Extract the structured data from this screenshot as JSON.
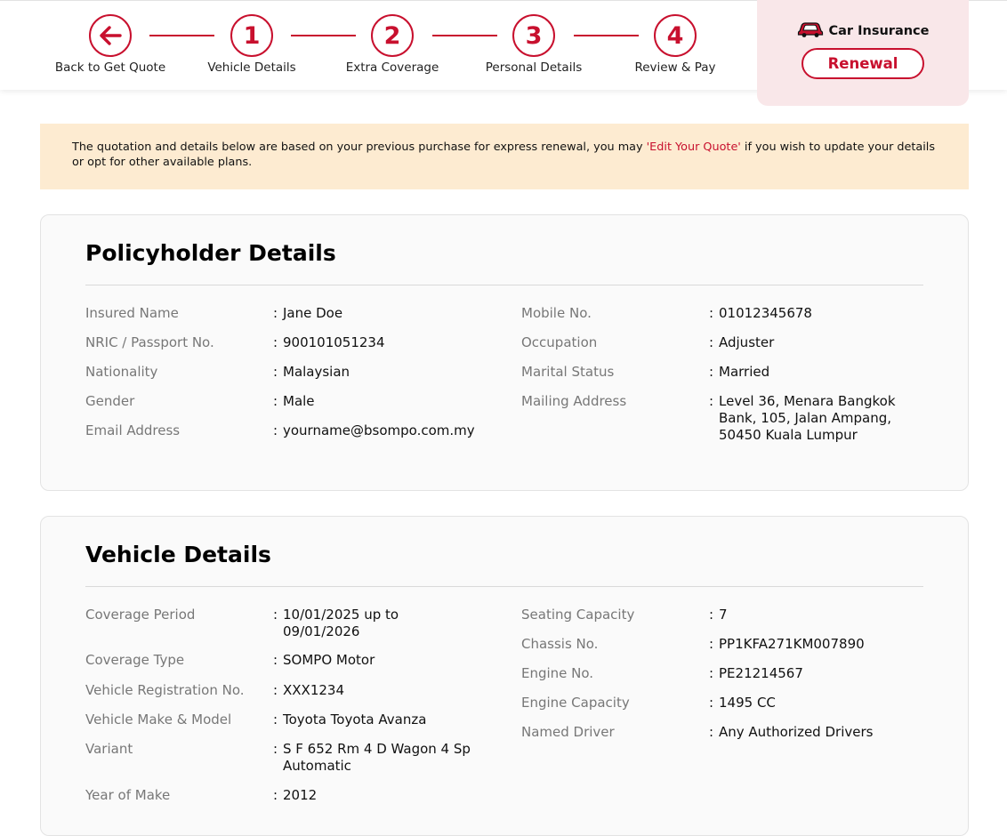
{
  "colors": {
    "accent": "#c8102e",
    "notice_bg": "#fdebd1",
    "panel_bg": "#f9e7e9"
  },
  "stepper": {
    "steps": [
      {
        "symbol": "←",
        "label": "Back to Get Quote",
        "icon": "arrow-left-icon"
      },
      {
        "symbol": "1",
        "label": "Vehicle Details"
      },
      {
        "symbol": "2",
        "label": "Extra Coverage"
      },
      {
        "symbol": "3",
        "label": "Personal Details"
      },
      {
        "symbol": "4",
        "label": "Review & Pay"
      }
    ]
  },
  "product": {
    "icon": "car-icon",
    "title": "Car Insurance",
    "button": "Renewal"
  },
  "notice": {
    "before": "The quotation and details below are based on your previous purchase for express renewal, you may ",
    "link": "'Edit Your Quote'",
    "after": " if you wish to update your details or opt for other available plans."
  },
  "policyholder": {
    "title": "Policyholder Details",
    "left": [
      {
        "label": "Insured Name",
        "value": "Jane Doe"
      },
      {
        "label": "NRIC / Passport No.",
        "value": "900101051234"
      },
      {
        "label": "Nationality",
        "value": "Malaysian"
      },
      {
        "label": "Gender",
        "value": "Male"
      },
      {
        "label": "Email Address",
        "value": "yourname@bsompo.com.my"
      }
    ],
    "right": [
      {
        "label": "Mobile No.",
        "value": "01012345678"
      },
      {
        "label": "Occupation",
        "value": "Adjuster"
      },
      {
        "label": "Marital Status",
        "value": "Married"
      },
      {
        "label": "Mailing Address",
        "value": "Level 36, Menara Bangkok Bank, 105, Jalan Ampang, 50450 Kuala Lumpur"
      }
    ]
  },
  "vehicle": {
    "title": "Vehicle Details",
    "left": [
      {
        "label": "Coverage Period",
        "value": "10/01/2025 up to 09/01/2026"
      },
      {
        "label": "Coverage Type",
        "value": "SOMPO Motor"
      },
      {
        "label": "Vehicle Registration No.",
        "value": "XXX1234"
      },
      {
        "label": "Vehicle Make & Model",
        "value": "Toyota Toyota Avanza"
      },
      {
        "label": "Variant",
        "value": "S F 652 Rm 4 D Wagon 4 Sp Automatic"
      },
      {
        "label": "Year of Make",
        "value": "2012"
      }
    ],
    "right": [
      {
        "label": "Seating Capacity",
        "value": "7"
      },
      {
        "label": "Chassis No.",
        "value": "PP1KFA271KM007890"
      },
      {
        "label": "Engine No.",
        "value": "PE21214567"
      },
      {
        "label": "Engine Capacity",
        "value": "1495 CC"
      },
      {
        "label": "Named Driver",
        "value": "Any Authorized Drivers"
      }
    ]
  }
}
